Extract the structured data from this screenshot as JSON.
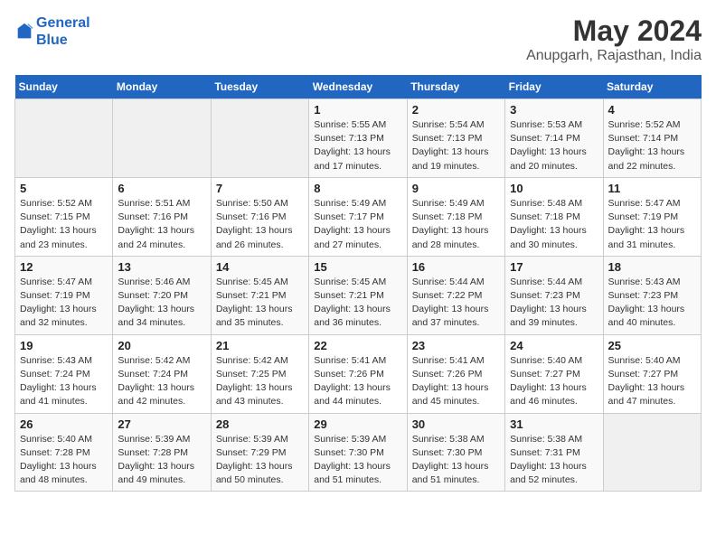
{
  "logo": {
    "line1": "General",
    "line2": "Blue"
  },
  "title": "May 2024",
  "subtitle": "Anupgarh, Rajasthan, India",
  "weekdays": [
    "Sunday",
    "Monday",
    "Tuesday",
    "Wednesday",
    "Thursday",
    "Friday",
    "Saturday"
  ],
  "weeks": [
    [
      {
        "num": "",
        "info": ""
      },
      {
        "num": "",
        "info": ""
      },
      {
        "num": "",
        "info": ""
      },
      {
        "num": "1",
        "info": "Sunrise: 5:55 AM\nSunset: 7:13 PM\nDaylight: 13 hours\nand 17 minutes."
      },
      {
        "num": "2",
        "info": "Sunrise: 5:54 AM\nSunset: 7:13 PM\nDaylight: 13 hours\nand 19 minutes."
      },
      {
        "num": "3",
        "info": "Sunrise: 5:53 AM\nSunset: 7:14 PM\nDaylight: 13 hours\nand 20 minutes."
      },
      {
        "num": "4",
        "info": "Sunrise: 5:52 AM\nSunset: 7:14 PM\nDaylight: 13 hours\nand 22 minutes."
      }
    ],
    [
      {
        "num": "5",
        "info": "Sunrise: 5:52 AM\nSunset: 7:15 PM\nDaylight: 13 hours\nand 23 minutes."
      },
      {
        "num": "6",
        "info": "Sunrise: 5:51 AM\nSunset: 7:16 PM\nDaylight: 13 hours\nand 24 minutes."
      },
      {
        "num": "7",
        "info": "Sunrise: 5:50 AM\nSunset: 7:16 PM\nDaylight: 13 hours\nand 26 minutes."
      },
      {
        "num": "8",
        "info": "Sunrise: 5:49 AM\nSunset: 7:17 PM\nDaylight: 13 hours\nand 27 minutes."
      },
      {
        "num": "9",
        "info": "Sunrise: 5:49 AM\nSunset: 7:18 PM\nDaylight: 13 hours\nand 28 minutes."
      },
      {
        "num": "10",
        "info": "Sunrise: 5:48 AM\nSunset: 7:18 PM\nDaylight: 13 hours\nand 30 minutes."
      },
      {
        "num": "11",
        "info": "Sunrise: 5:47 AM\nSunset: 7:19 PM\nDaylight: 13 hours\nand 31 minutes."
      }
    ],
    [
      {
        "num": "12",
        "info": "Sunrise: 5:47 AM\nSunset: 7:19 PM\nDaylight: 13 hours\nand 32 minutes."
      },
      {
        "num": "13",
        "info": "Sunrise: 5:46 AM\nSunset: 7:20 PM\nDaylight: 13 hours\nand 34 minutes."
      },
      {
        "num": "14",
        "info": "Sunrise: 5:45 AM\nSunset: 7:21 PM\nDaylight: 13 hours\nand 35 minutes."
      },
      {
        "num": "15",
        "info": "Sunrise: 5:45 AM\nSunset: 7:21 PM\nDaylight: 13 hours\nand 36 minutes."
      },
      {
        "num": "16",
        "info": "Sunrise: 5:44 AM\nSunset: 7:22 PM\nDaylight: 13 hours\nand 37 minutes."
      },
      {
        "num": "17",
        "info": "Sunrise: 5:44 AM\nSunset: 7:23 PM\nDaylight: 13 hours\nand 39 minutes."
      },
      {
        "num": "18",
        "info": "Sunrise: 5:43 AM\nSunset: 7:23 PM\nDaylight: 13 hours\nand 40 minutes."
      }
    ],
    [
      {
        "num": "19",
        "info": "Sunrise: 5:43 AM\nSunset: 7:24 PM\nDaylight: 13 hours\nand 41 minutes."
      },
      {
        "num": "20",
        "info": "Sunrise: 5:42 AM\nSunset: 7:24 PM\nDaylight: 13 hours\nand 42 minutes."
      },
      {
        "num": "21",
        "info": "Sunrise: 5:42 AM\nSunset: 7:25 PM\nDaylight: 13 hours\nand 43 minutes."
      },
      {
        "num": "22",
        "info": "Sunrise: 5:41 AM\nSunset: 7:26 PM\nDaylight: 13 hours\nand 44 minutes."
      },
      {
        "num": "23",
        "info": "Sunrise: 5:41 AM\nSunset: 7:26 PM\nDaylight: 13 hours\nand 45 minutes."
      },
      {
        "num": "24",
        "info": "Sunrise: 5:40 AM\nSunset: 7:27 PM\nDaylight: 13 hours\nand 46 minutes."
      },
      {
        "num": "25",
        "info": "Sunrise: 5:40 AM\nSunset: 7:27 PM\nDaylight: 13 hours\nand 47 minutes."
      }
    ],
    [
      {
        "num": "26",
        "info": "Sunrise: 5:40 AM\nSunset: 7:28 PM\nDaylight: 13 hours\nand 48 minutes."
      },
      {
        "num": "27",
        "info": "Sunrise: 5:39 AM\nSunset: 7:28 PM\nDaylight: 13 hours\nand 49 minutes."
      },
      {
        "num": "28",
        "info": "Sunrise: 5:39 AM\nSunset: 7:29 PM\nDaylight: 13 hours\nand 50 minutes."
      },
      {
        "num": "29",
        "info": "Sunrise: 5:39 AM\nSunset: 7:30 PM\nDaylight: 13 hours\nand 51 minutes."
      },
      {
        "num": "30",
        "info": "Sunrise: 5:38 AM\nSunset: 7:30 PM\nDaylight: 13 hours\nand 51 minutes."
      },
      {
        "num": "31",
        "info": "Sunrise: 5:38 AM\nSunset: 7:31 PM\nDaylight: 13 hours\nand 52 minutes."
      },
      {
        "num": "",
        "info": ""
      }
    ]
  ]
}
